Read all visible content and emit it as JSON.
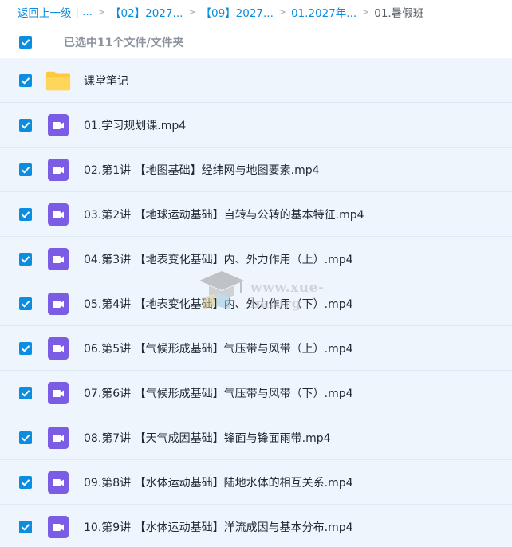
{
  "breadcrumb": {
    "back": "返回上一级",
    "ellipsis": "...",
    "crumbs": [
      "【02】2027...",
      "【09】2027...",
      "01.2027年..."
    ],
    "current": "01.暑假班"
  },
  "selection": {
    "summary": "已选中11个文件/文件夹",
    "all_checked": true
  },
  "files": [
    {
      "name": "课堂笔记",
      "type": "folder",
      "checked": true
    },
    {
      "name": "01.学习规划课.mp4",
      "type": "video",
      "checked": true
    },
    {
      "name": "02.第1讲 【地图基础】经纬网与地图要素.mp4",
      "type": "video",
      "checked": true
    },
    {
      "name": "03.第2讲 【地球运动基础】自转与公转的基本特征.mp4",
      "type": "video",
      "checked": true
    },
    {
      "name": "04.第3讲 【地表变化基础】内、外力作用（上）.mp4",
      "type": "video",
      "checked": true
    },
    {
      "name": "05.第4讲 【地表变化基础】内、外力作用（下）.mp4",
      "type": "video",
      "checked": true
    },
    {
      "name": "06.第5讲 【气候形成基础】气压带与风带（上）.mp4",
      "type": "video",
      "checked": true
    },
    {
      "name": "07.第6讲 【气候形成基础】气压带与风带（下）.mp4",
      "type": "video",
      "checked": true
    },
    {
      "name": "08.第7讲 【天气成因基础】锋面与锋面雨带.mp4",
      "type": "video",
      "checked": true
    },
    {
      "name": "09.第8讲 【水体运动基础】陆地水体的相互关系.mp4",
      "type": "video",
      "checked": true
    },
    {
      "name": "10.第9讲 【水体运动基础】洋流成因与基本分布.mp4",
      "type": "video",
      "checked": true
    }
  ],
  "watermark": {
    "text": "www.xue-ba.org"
  },
  "colors": {
    "accent": "#0b8de0",
    "row_background": "#eef5fc",
    "folder": "#ffc83d",
    "video_icon": "#7b5ce5"
  }
}
